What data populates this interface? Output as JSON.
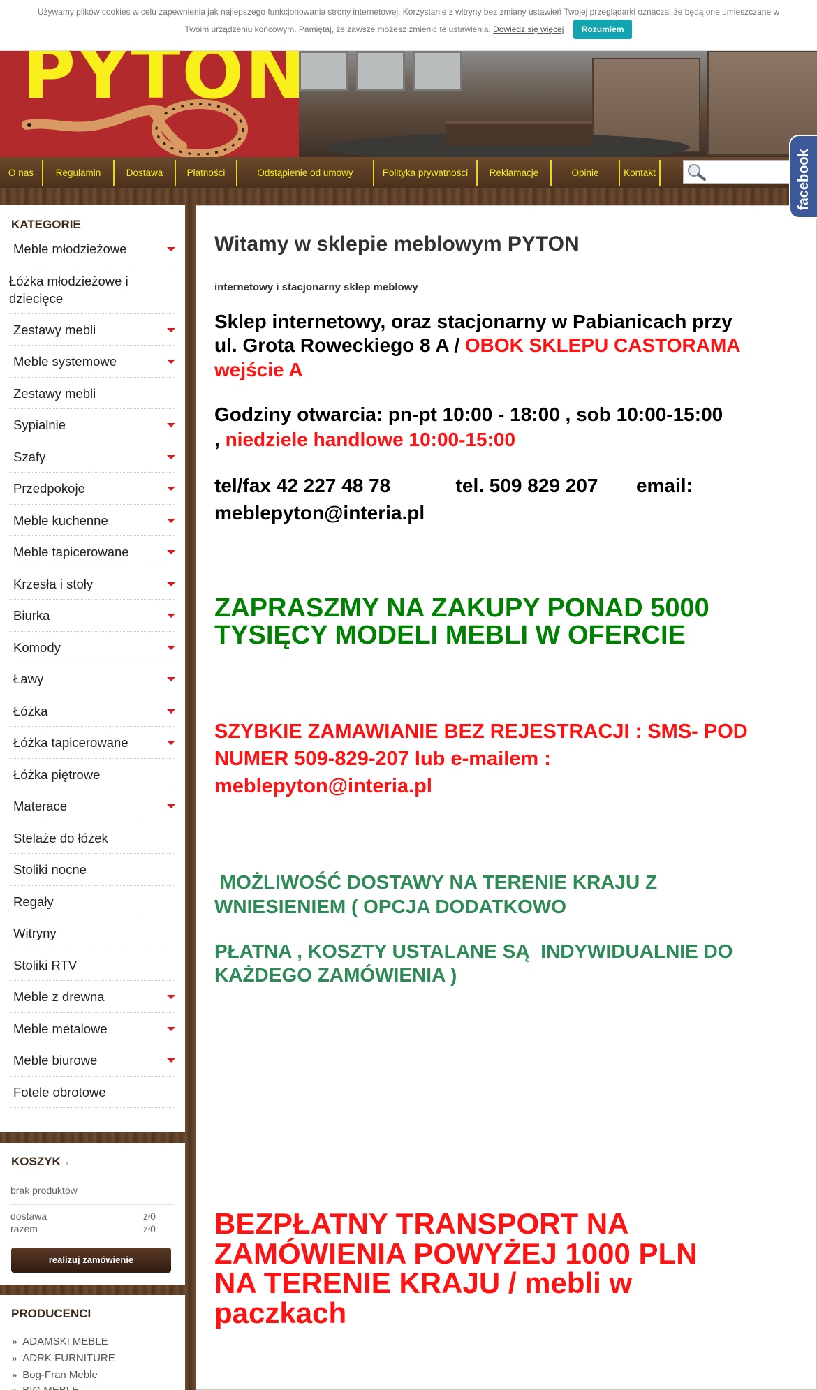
{
  "cookie": {
    "text_line1": "Używamy plików cookies w celu zapewnienia jak najlepszego funkcjonowania strony internetowej. Korzystanie z witryny bez zmiany ustawień Twojej przeglądarki oznacza, że będą one umieszczane w",
    "text_line2": "Twoim urządzeniu końcowym. Pamiętaj, że zawsze możesz zmienić te ustawienia.",
    "link": "Dowiedz się więcej",
    "button": "Rozumiem"
  },
  "header": {
    "logo": "PYTON",
    "facebook": "facebook"
  },
  "menu": [
    "O nas",
    "Regulamin",
    "Dostawa",
    "Płatności",
    "Odstąpienie od umowy",
    "Polityka prywatności",
    "Reklamacje",
    "Opinie",
    "Kontakt"
  ],
  "search": {
    "placeholder": ""
  },
  "categories": {
    "title": "KATEGORIE",
    "items": [
      {
        "label": "Meble młodzieżowe",
        "arrow": true
      },
      {
        "label": "Łóżka młodzieżowe i dziecięce",
        "arrow": false
      },
      {
        "label": "Zestawy mebli",
        "arrow": true
      },
      {
        "label": "Meble systemowe",
        "arrow": true
      },
      {
        "label": "Zestawy mebli",
        "arrow": false
      },
      {
        "label": "Sypialnie",
        "arrow": true
      },
      {
        "label": "Szafy",
        "arrow": true
      },
      {
        "label": "Przedpokoje",
        "arrow": true
      },
      {
        "label": "Meble kuchenne",
        "arrow": true
      },
      {
        "label": "Meble tapicerowane",
        "arrow": true
      },
      {
        "label": "Krzesła i stoły",
        "arrow": true
      },
      {
        "label": "Biurka",
        "arrow": true
      },
      {
        "label": "Komody",
        "arrow": true
      },
      {
        "label": "Ławy",
        "arrow": true
      },
      {
        "label": "Łóżka",
        "arrow": true
      },
      {
        "label": "Łóżka tapicerowane",
        "arrow": true
      },
      {
        "label": "Łóżka piętrowe",
        "arrow": false
      },
      {
        "label": "Materace",
        "arrow": true
      },
      {
        "label": "Stelaże do łóżek",
        "arrow": false
      },
      {
        "label": "Stoliki nocne",
        "arrow": false
      },
      {
        "label": "Regały",
        "arrow": false
      },
      {
        "label": "Witryny",
        "arrow": false
      },
      {
        "label": "Stoliki RTV",
        "arrow": false
      },
      {
        "label": "Meble z drewna",
        "arrow": true
      },
      {
        "label": "Meble metalowe",
        "arrow": true
      },
      {
        "label": "Meble biurowe",
        "arrow": true
      },
      {
        "label": "Fotele obrotowe",
        "arrow": false
      }
    ]
  },
  "cart": {
    "title": "KOSZYK",
    "empty": "brak produktów",
    "delivery_label": "dostawa",
    "delivery_value": "zł0",
    "total_label": "razem",
    "total_value": "zł0",
    "button": "realizuj zamówienie"
  },
  "producers": {
    "title": "PRODUCENCI",
    "items": [
      "ADAMSKI MEBLE",
      "ADRK FURNITURE",
      "Bog-Fran Meble",
      "BIG MEBLE"
    ]
  },
  "main": {
    "title": "Witamy w sklepie meblowym PYTON",
    "subtitle": "internetowy i stacjonarny sklep meblowy",
    "address_a": "Sklep internetowy, oraz stacjonarny w Pabianicach przy",
    "address_b": "ul. Grota Roweckiego 8 A / ",
    "address_b_red": "OBOK SKLEPU CASTORAMA",
    "address_c_red": "wejście A",
    "hours_a": "Godziny otwarcia:  pn-pt 10:00 - 18:00  , sob 10:00-15:00",
    "hours_b": ", ",
    "hours_b_red": "niedziele handlowe 10:00-15:00",
    "contact_a": "tel/fax 42 227 48 78            tel. 509 829 207       email:",
    "contact_b": "meblepyton@interia.pl",
    "invite_1": "ZAPRASZMY NA ZAKUPY PONAD 5000",
    "invite_2": "TYSIĘCY MODELI MEBLI W OFERCIE",
    "order_1": "SZYBKIE ZAMAWIANIE BEZ REJESTRACJI : SMS- POD",
    "order_2": "NUMER 509-829-207 lub e-mailem :",
    "order_3": "meblepyton@interia.pl",
    "delivery_1": " MOŻLIWOŚĆ DOSTAWY NA TERENIE KRAJU Z",
    "delivery_2": "WNIESIENIEM ( OPCJA DODATKOWO",
    "delivery_3": "PŁATNA , KOSZTY USTALANE SĄ  INDYWIDUALNIE DO",
    "delivery_4": "KAŻDEGO ZAMÓWIENIA )",
    "free_1": "BEZPŁATNY TRANSPORT NA",
    "free_2": "ZAMÓWIENIA POWYŻEJ 1000 PLN",
    "free_3": "NA TERENIE KRAJU / mebli w",
    "free_4": "paczkach"
  }
}
